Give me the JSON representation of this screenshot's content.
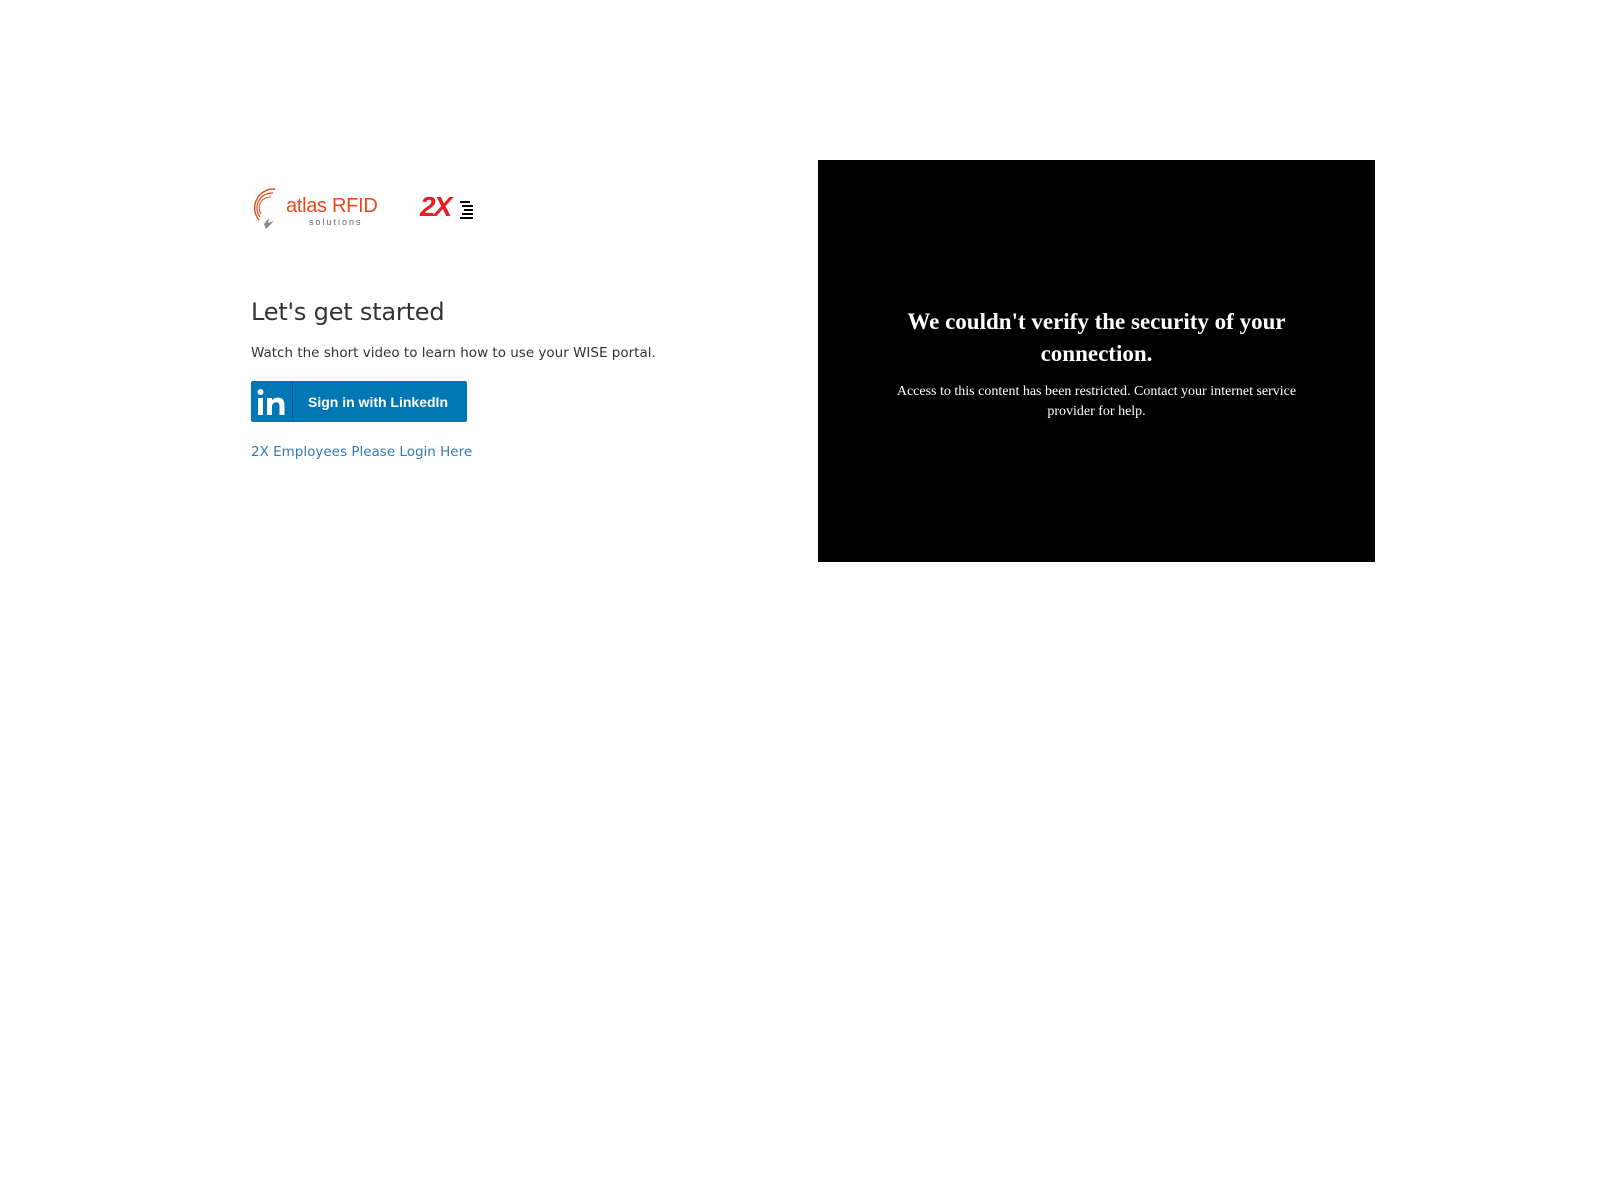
{
  "brand": {
    "atlas_name": "atlas RFID",
    "atlas_sub": "solutions",
    "partner_mark": "2X",
    "accent": "#e8491d"
  },
  "main": {
    "heading": "Let's get started",
    "intro": "Watch the short video to learn how to use your WISE portal.",
    "linkedin_button": {
      "label": "Sign in with LinkedIn",
      "icon": "linkedin-icon",
      "color": "#0077b5"
    },
    "employee_link": "2X Employees Please Login Here",
    "link_color": "#337ab7"
  },
  "video": {
    "title": "We couldn't verify the security of your connection.",
    "body": "Access to this content has been restricted. Contact your internet service provider for help."
  }
}
